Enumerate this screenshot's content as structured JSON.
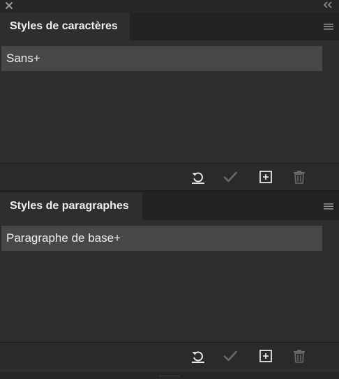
{
  "window": {
    "close_icon": "close-icon",
    "collapse_icon": "double-chevron-left-icon"
  },
  "character_styles": {
    "tab_label": "Styles de caractères",
    "menu_icon": "panel-menu-icon",
    "items": [
      {
        "label": "Sans+",
        "selected": true
      }
    ],
    "footer_icons": [
      "redefine-style-icon",
      "apply-checkmark-icon",
      "new-style-icon",
      "trash-icon"
    ]
  },
  "paragraph_styles": {
    "tab_label": "Styles de paragraphes",
    "menu_icon": "panel-menu-icon",
    "items": [
      {
        "label": "Paragraphe de base+",
        "selected": true
      }
    ],
    "footer_icons": [
      "redefine-style-icon",
      "apply-checkmark-icon",
      "new-style-icon",
      "trash-icon"
    ]
  },
  "colors": {
    "panel_bg": "#2e2e2e",
    "selected_row": "#474747",
    "icon_active": "#e6e6e6",
    "icon_disabled": "#6a6a6a"
  }
}
